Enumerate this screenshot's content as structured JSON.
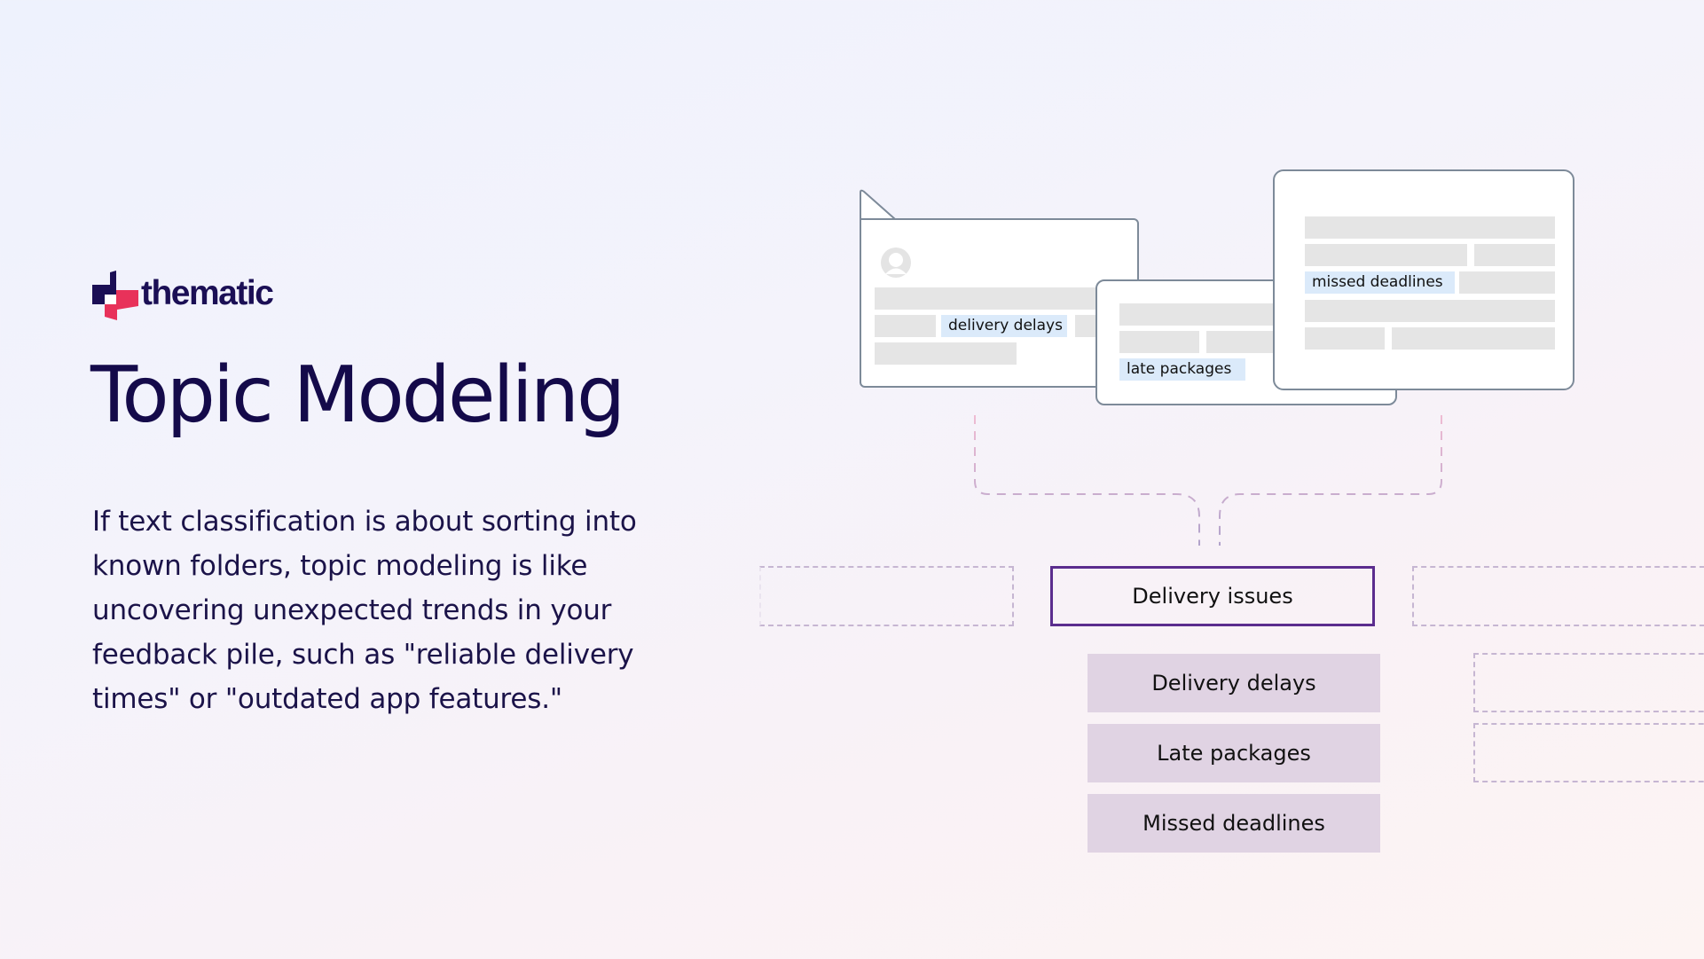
{
  "brand": {
    "logo_icon": "thematic-logo-icon",
    "name": "thematic",
    "colors": {
      "navy": "#1b0f55",
      "accent": "#e8325a"
    }
  },
  "title": "Topic Modeling",
  "description": "If text classification is about sorting into known folders, topic modeling is like uncovering unexpected trends in your feedback pile, such as \"reliable delivery times\" or \"outdated app features.\"",
  "diagram": {
    "feedback_cards": [
      {
        "avatar_icon": "user-avatar-icon",
        "highlight": "delivery delays"
      },
      {
        "highlight": "late packages"
      },
      {
        "highlight": "missed deadlines"
      }
    ],
    "main_topic": "Delivery issues",
    "subtopics": [
      "Delivery delays",
      "Late packages",
      "Missed deadlines"
    ],
    "colors": {
      "card_border": "#7d8a99",
      "placeholder": "#e5e5e5",
      "highlight": "#dbeafa",
      "main_topic_border": "#5b2d8e",
      "subtopic_fill": "#e0d3e3",
      "connector": "#c9b0cf"
    }
  }
}
